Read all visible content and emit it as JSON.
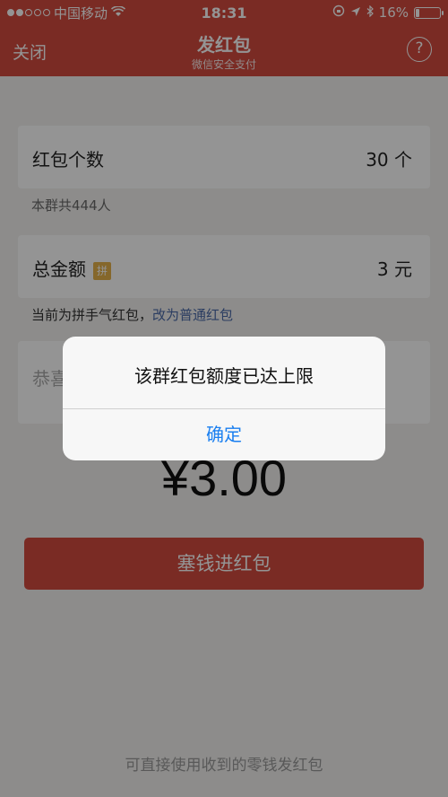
{
  "status_bar": {
    "carrier": "中国移动",
    "time": "18:31",
    "battery": "16%",
    "battery_level": 0.16
  },
  "nav": {
    "close_label": "关闭",
    "title": "发红包",
    "subtitle": "微信安全支付",
    "help_label": "?"
  },
  "form": {
    "count": {
      "label": "红包个数",
      "value": "30 个"
    },
    "group_members": "本群共444人",
    "total": {
      "label": "总金额",
      "badge": "拼",
      "value": "3 元"
    },
    "mode_hint": "当前为拼手气红包，",
    "switch_link": "改为普通红包",
    "greeting": "恭喜"
  },
  "amount_display": "¥3.00",
  "submit_label": "塞钱进红包",
  "footer_hint": "可直接使用收到的零钱发红包",
  "dialog": {
    "message": "该群红包额度已达上限",
    "confirm_label": "确定"
  },
  "colors": {
    "brand_red": "#d24a3e",
    "link_blue": "#1a7ff0",
    "badge_gold": "#e5b14a"
  }
}
